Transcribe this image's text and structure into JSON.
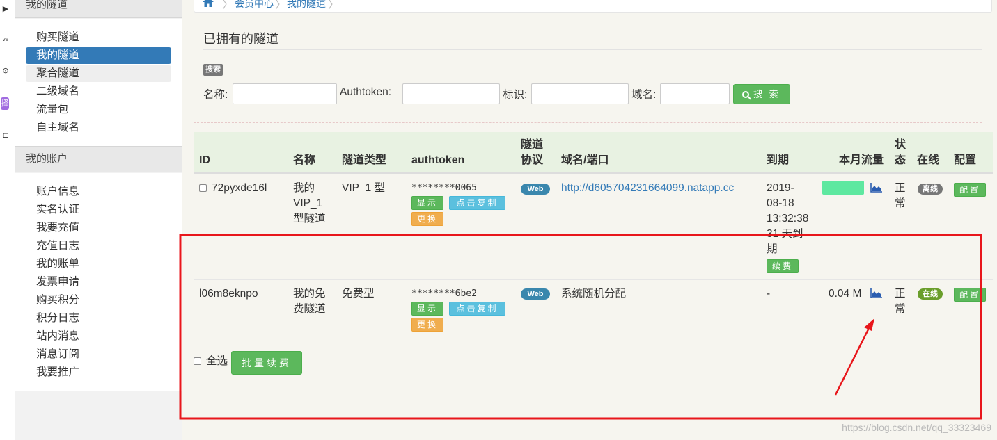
{
  "sidebar": {
    "groups": [
      {
        "title": "我的隧道",
        "items": [
          "购买隧道",
          "我的隧道",
          "聚合隧道",
          "二级域名",
          "流量包",
          "自主域名"
        ]
      },
      {
        "title": "我的账户",
        "items": [
          "账户信息",
          "实名认证",
          "我要充值",
          "充值日志",
          "我的账单",
          "发票申请",
          "购买积分",
          "积分日志",
          "站内消息",
          "消息订阅",
          "我要推广"
        ]
      }
    ],
    "active_item": "我的隧道"
  },
  "iconbar": {
    "icon4_text": "择"
  },
  "breadcrumb": {
    "level1": "会员中心",
    "level2": "我的隧道"
  },
  "page": {
    "title": "已拥有的隧道"
  },
  "search": {
    "badge": "搜索",
    "name_label": "名称:",
    "authtoken_label": "Authtoken:",
    "tag_label": "标识:",
    "domain_label": "域名:",
    "button_label": "搜 索"
  },
  "table": {
    "headers": {
      "id": "ID",
      "name": "名称",
      "type": "隧道类型",
      "authtoken": "authtoken",
      "protocol_1": "隧道",
      "protocol_2": "协议",
      "domain": "域名/端口",
      "expire": "到期",
      "traffic": "本月流量",
      "status_1": "状",
      "status_2": "态",
      "online": "在线",
      "config": "配置"
    },
    "rows": [
      {
        "id": "72pyxde16l",
        "name_lines": [
          "我的",
          "VIP_1",
          "型隧道"
        ],
        "type": "VIP_1 型",
        "authtoken": "********0065",
        "show_btn": "显示",
        "copy_btn": "点击复制",
        "change_btn": "更换",
        "protocol": "Web",
        "domain": "http://d605704231664099.natapp.cc",
        "expire_lines": [
          "2019-",
          "08-18",
          "13:32:38",
          "31 天到",
          "期"
        ],
        "renew_btn": "续费",
        "traffic": "",
        "status_lines": [
          "正",
          "常"
        ],
        "online": "离线",
        "config_btn": "配置"
      },
      {
        "id": "l06m8eknpo",
        "name_lines": [
          "我的免",
          "费隧道"
        ],
        "type": "免费型",
        "authtoken": "********6be2",
        "show_btn": "显示",
        "copy_btn": "点击复制",
        "change_btn": "更换",
        "protocol": "Web",
        "domain": "系统随机分配",
        "expire_lines": [
          "-"
        ],
        "traffic": "0.04 M",
        "status_lines": [
          "正",
          "常"
        ],
        "online": "在线",
        "config_btn": "配置"
      }
    ],
    "select_all": "全选",
    "batch_renew": "批量续费"
  },
  "watermark": "https://blog.csdn.net/qq_33323469",
  "colors": {
    "primary": "#337ab7",
    "success": "#5cb85c",
    "info": "#5bc0de",
    "warning": "#f0ad4e",
    "annotation": "#e8161b"
  }
}
